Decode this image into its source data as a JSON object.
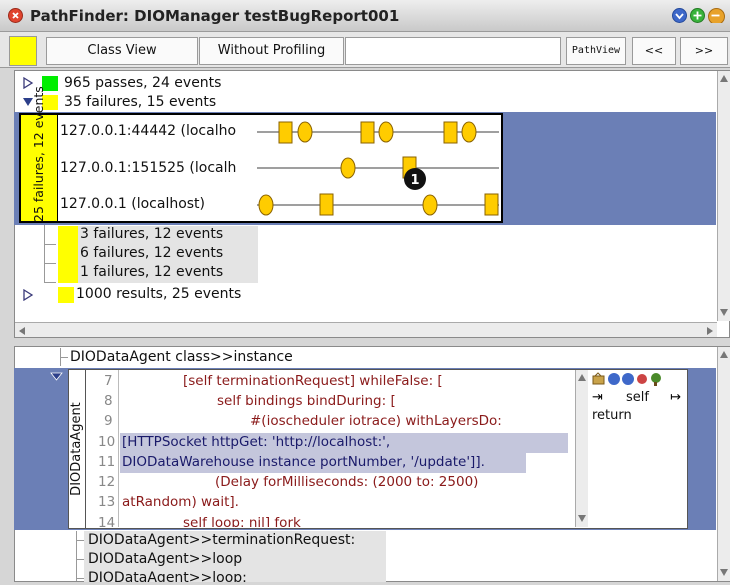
{
  "window": {
    "title": "PathFinder: DIOManager testBugReport001"
  },
  "toolbar": {
    "class_view": "Class View",
    "without_profiling": "Without Profiling",
    "path_view": "PathView",
    "prev": "<<",
    "next": ">>"
  },
  "tree": {
    "passes": "965 passes, 24 events",
    "failures": "35 failures, 15 events",
    "group_label": "25 failures, 12 events",
    "hosts": [
      "127.0.0.1:44442 (localho",
      "127.0.0.1:151525 (localh",
      "127.0.0.1 (localhost)"
    ],
    "badge": "1",
    "sub_failures": [
      "3 failures, 12 events",
      "6 failures, 12 events",
      "1 failures, 12 events"
    ],
    "results": "1000 results, 25 events"
  },
  "lower": {
    "header": "DIODataAgent class>>instance",
    "side_label": "DIODataAgent",
    "code_lines": [
      {
        "n": "7",
        "text": "[self terminationRequest] whileFalse: ["
      },
      {
        "n": "8",
        "text": "self bindings bindDuring: ["
      },
      {
        "n": "9",
        "text": "#(ioscheduler iotrace) withLayersDo:"
      },
      {
        "n": "10",
        "text": "[HTTPSocket httpGet: 'http://localhost:',"
      },
      {
        "n": "11",
        "text": "DIODataWarehouse instance portNumber, '/update']]."
      },
      {
        "n": "12",
        "text": "(Delay forMilliseconds: (2000 to: 2500)"
      },
      {
        "n": "13",
        "text": "atRandom) wait]."
      },
      {
        "n": "14",
        "text": "self loop: nil] fork"
      }
    ],
    "stack": {
      "self": "self",
      "return": "return"
    },
    "methods": [
      "DIODataAgent>>terminationRequest:",
      "DIODataAgent>>loop",
      "DIODataAgent>>loop:"
    ]
  },
  "colors": {
    "selection_blue": "#6b7fb6",
    "highlight_yellow": "#ffff00",
    "pass_green": "#00ee00",
    "event_orange": "#ffcc00"
  }
}
